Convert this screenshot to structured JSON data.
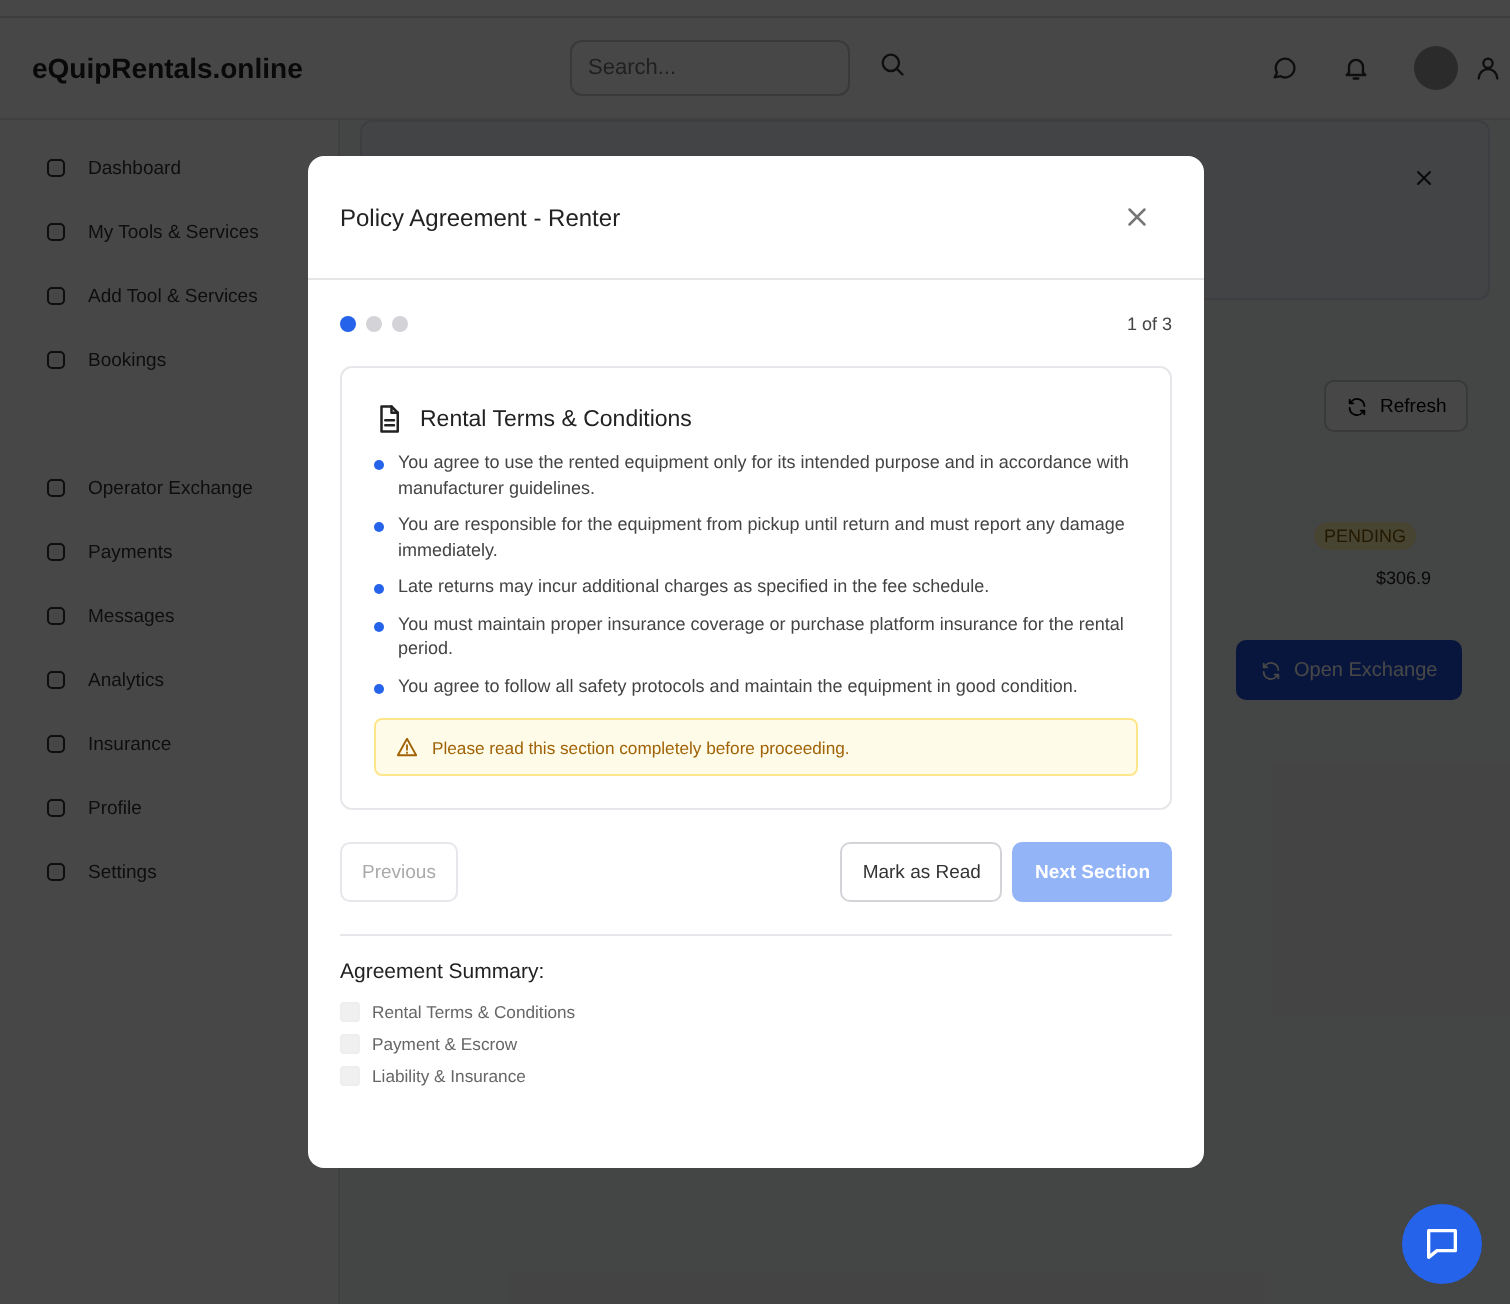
{
  "header": {
    "brand": "eQuipRentals.online",
    "search": {
      "placeholder": "Search..."
    }
  },
  "sidebar": {
    "items": [
      {
        "label": "Dashboard"
      },
      {
        "label": "My Tools & Services"
      },
      {
        "label": "Add Tool & Services"
      },
      {
        "label": "Bookings"
      },
      {
        "label": "Operator Exchange"
      },
      {
        "label": "Payments"
      },
      {
        "label": "Messages"
      },
      {
        "label": "Analytics"
      },
      {
        "label": "Insurance"
      },
      {
        "label": "Profile"
      },
      {
        "label": "Settings"
      }
    ]
  },
  "main": {
    "refresh": "Refresh",
    "status": "PENDING",
    "amount": "$306.9",
    "open_exchange": "Open Exchange"
  },
  "modal": {
    "title": "Policy Agreement - Renter",
    "steps": [
      {
        "selected": true
      },
      {
        "selected": false
      },
      {
        "selected": false
      }
    ],
    "step_counter": "1 of 3",
    "section": {
      "title": "Rental Terms & Conditions",
      "terms": [
        "You agree to use the rented equipment only for its intended purpose and in accordance with manufacturer guidelines.",
        "You are responsible for the equipment from pickup until return and must report any damage immediately.",
        "Late returns may incur additional charges as specified in the fee schedule.",
        "You must maintain proper insurance coverage or purchase platform insurance for the rental period.",
        "You agree to follow all safety protocols and maintain the equipment in good condition."
      ],
      "notice": "Please read this section completely before proceeding."
    },
    "buttons": [
      {
        "label": "Previous",
        "kind": "outline",
        "disabled": true
      },
      {
        "label": "Mark as Read",
        "kind": "outline",
        "disabled": false
      },
      {
        "label": "Next Section",
        "kind": "primary",
        "disabled": true
      }
    ],
    "summary": {
      "title": "Agreement Summary:",
      "items": [
        {
          "label": "Rental Terms & Conditions",
          "checked": false
        },
        {
          "label": "Payment & Escrow",
          "checked": false
        },
        {
          "label": "Liability & Insurance",
          "checked": false
        }
      ]
    }
  }
}
